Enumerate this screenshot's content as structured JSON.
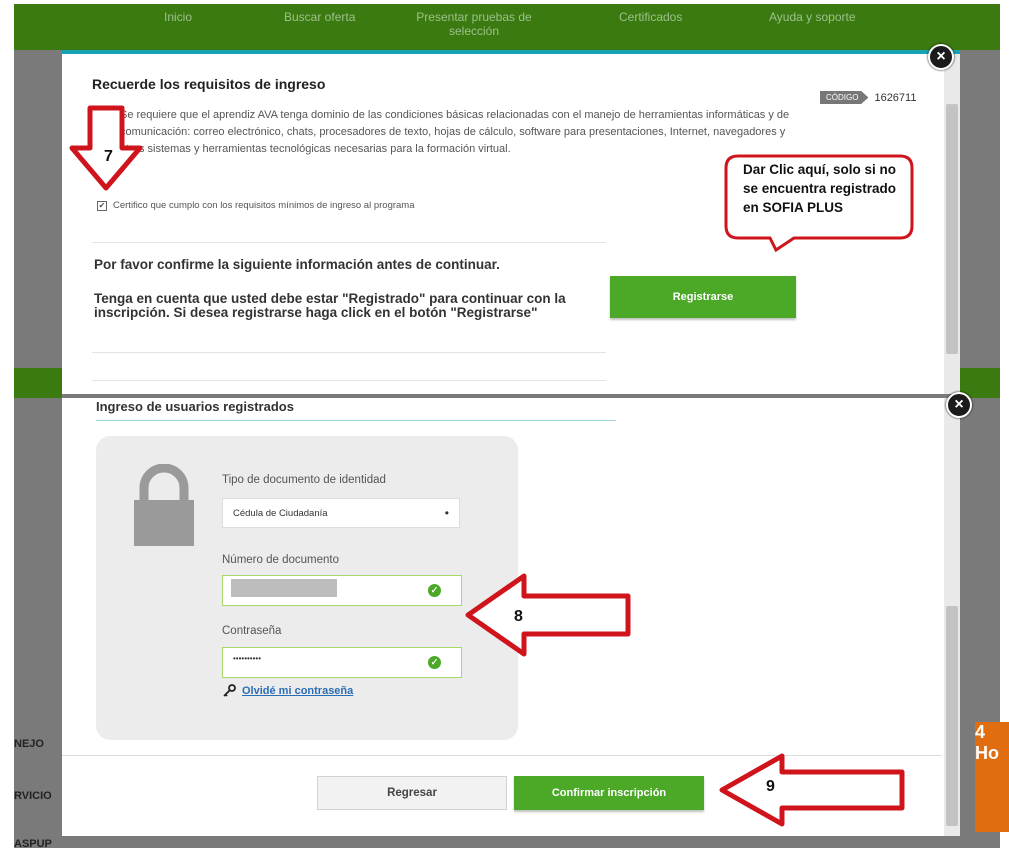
{
  "background": {
    "nav_items": [
      "Inicio",
      "Buscar oferta",
      "Presentar pruebas de selección",
      "Certificados",
      "Ayuda y soporte"
    ],
    "side_texts": [
      "NEJO",
      "RVICIO",
      "ASPUP"
    ],
    "orange_text": "4 Ho"
  },
  "modal_requisitos": {
    "title": "Recuerde los requisitos de ingreso",
    "codigo_label": "CÓDIGO",
    "codigo_value": "1626711",
    "body": "Se requiere que el aprendiz AVA tenga dominio de las condiciones básicas relacionadas con el manejo de herramientas informáticas y de comunicación: correo electrónico, chats, procesadores de texto, hojas de cálculo, software para presentaciones, Internet, navegadores y otros sistemas y herramientas tecnológicas necesarias para la formación virtual.",
    "certify_label": "Certifico que cumplo con los requisitos mínimos de ingreso al programa",
    "certify_checked": true,
    "confirm_title": "Por favor confirme la siguiente información antes de continuar.",
    "confirm_note": "Tenga en cuenta que usted debe estar \"Registrado\" para continuar con la inscripción. Si desea registrarse haga click en el botón \"Registrarse\"",
    "register_button": "Registrarse",
    "close": "×"
  },
  "modal_login": {
    "title": "Ingreso de usuarios registrados",
    "doc_type_label": "Tipo de documento de identidad",
    "doc_type_value": "Cédula de Ciudadanía",
    "doc_number_label": "Número de documento",
    "password_label": "Contraseña",
    "password_mask": "••••••••••",
    "forgot_link": "Olvidé mi contraseña",
    "back_button": "Regresar",
    "confirm_button": "Confirmar inscripción",
    "close": "×"
  },
  "annotations": {
    "step7": "7",
    "step8": "8",
    "step9": "9",
    "callout": "Dar Clic aquí, solo si no se encuentra registrado en SOFIA PLUS"
  },
  "colors": {
    "brand_green": "#4ca928",
    "nav_green": "#3b7a10",
    "annotation_red": "#d0141c",
    "accent_teal": "#16a3b5"
  },
  "icons": [
    "lock-icon",
    "check-icon",
    "key-icon",
    "close-icon",
    "arrow-icon"
  ]
}
